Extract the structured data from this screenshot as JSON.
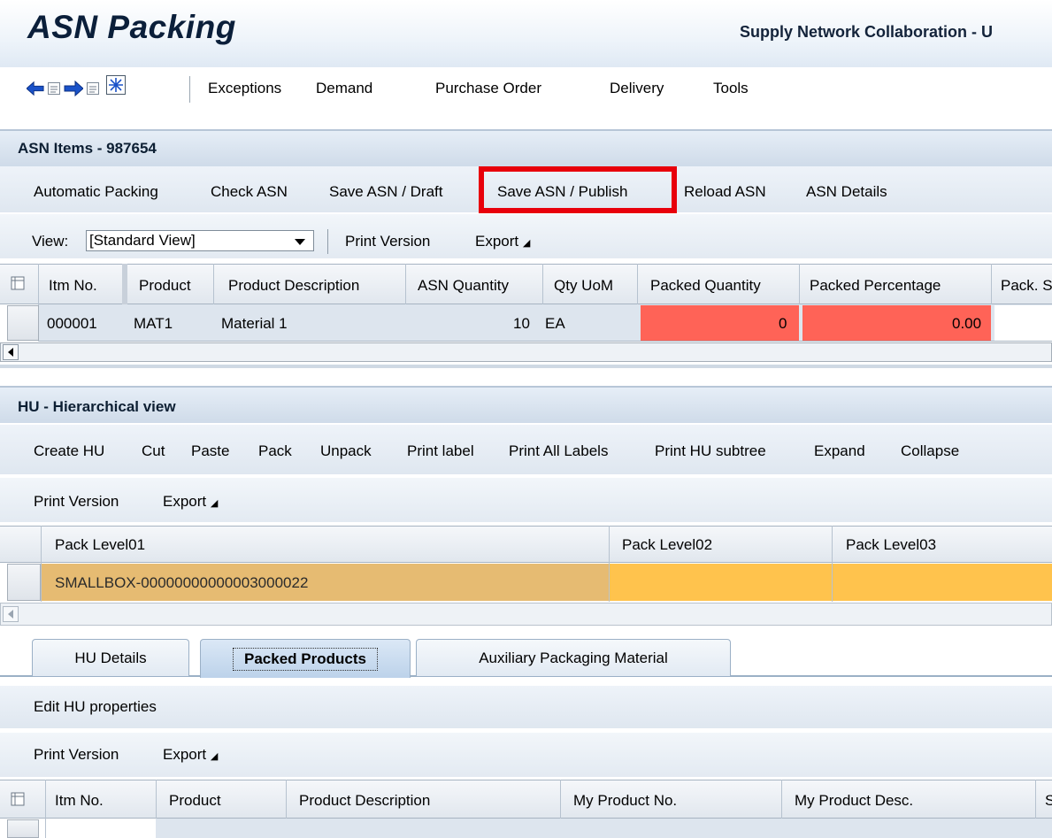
{
  "app": {
    "title": "ASN Packing",
    "subtitle": "Supply Network Collaboration - U"
  },
  "nav": {
    "icons": [
      "back-arrow-icon",
      "back-dropdown-icon",
      "forward-arrow-icon",
      "forward-dropdown-icon",
      "favorites-star-icon"
    ],
    "menu": [
      "Exceptions",
      "Demand",
      "Purchase Order",
      "Delivery",
      "Tools"
    ]
  },
  "asn_items": {
    "title": "ASN Items - 987654",
    "actions": [
      "Automatic Packing",
      "Check ASN",
      "Save ASN / Draft",
      "Save ASN / Publish",
      "Reload ASN",
      "ASN Details"
    ],
    "highlighted_action": "Save ASN / Publish",
    "view_label": "View:",
    "view_value": "[Standard View]",
    "print_version": "Print Version",
    "export": "Export",
    "columns": [
      "Itm No.",
      "Product",
      "Product Description",
      "ASN Quantity",
      "Qty UoM",
      "Packed Quantity",
      "Packed Percentage",
      "Pack. S"
    ],
    "rows": [
      {
        "itm_no": "000001",
        "product": "MAT1",
        "description": "Material 1",
        "asn_quantity": "10",
        "uom": "EA",
        "packed_quantity": "0",
        "packed_percentage": "0.00"
      }
    ]
  },
  "hu": {
    "title": "HU - Hierarchical view",
    "actions": [
      "Create HU",
      "Cut",
      "Paste",
      "Pack",
      "Unpack",
      "Print label",
      "Print All Labels",
      "Print HU subtree",
      "Expand",
      "Collapse"
    ],
    "print_version": "Print Version",
    "export": "Export",
    "columns": [
      "Pack Level01",
      "Pack Level02",
      "Pack Level03"
    ],
    "rows": [
      {
        "level01": "SMALLBOX-00000000000003000022",
        "level02": "",
        "level03": ""
      }
    ]
  },
  "tabs": {
    "items": [
      "HU Details",
      "Packed Products",
      "Auxiliary Packaging Material"
    ],
    "active": "Packed Products"
  },
  "packed_products": {
    "edit_label": "Edit HU properties",
    "print_version": "Print Version",
    "export": "Export",
    "columns": [
      "Itm No.",
      "Product",
      "Product Description",
      "My Product No.",
      "My Product Desc.",
      "S"
    ]
  },
  "colors": {
    "header_blue": "#cfdbe9",
    "highlight_red": "#e8000b",
    "packed_cell_red": "#ff6357",
    "hu_row_tan": "#e6bb72",
    "hu_row_yellow": "#ffc34d"
  }
}
